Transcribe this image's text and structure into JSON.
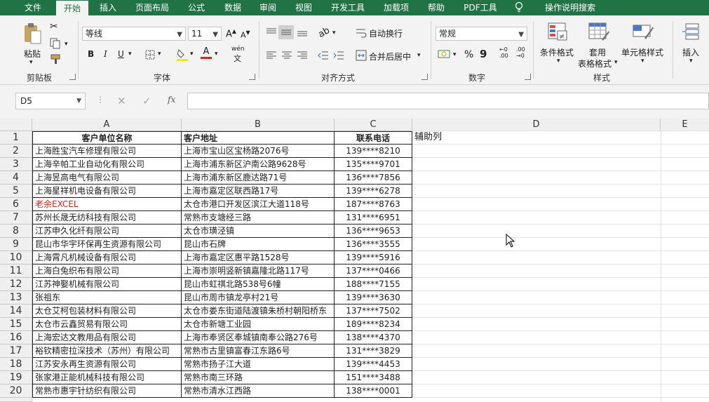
{
  "menu_tabs": [
    "文件",
    "开始",
    "插入",
    "页面布局",
    "公式",
    "数据",
    "审阅",
    "视图",
    "开发工具",
    "加载项",
    "帮助",
    "PDF工具",
    "操作说明搜索"
  ],
  "ribbon": {
    "clipboard": {
      "paste": "粘贴",
      "group": "剪贴板"
    },
    "font": {
      "name": "等线",
      "size": "11",
      "group": "字体",
      "bold": "B",
      "italic": "I",
      "underline": "U",
      "phonetic": "wén"
    },
    "alignment": {
      "wrap": "自动换行",
      "merge": "合并后居中",
      "group": "对齐方式"
    },
    "number": {
      "format": "常规",
      "percent": "%",
      "comma": "9",
      "group": "数字"
    },
    "styles": {
      "conditional": "条件格式",
      "table_format_1": "套用",
      "table_format_2": "表格格式",
      "cell_styles": "单元格样式",
      "group": "样式"
    },
    "cells": {
      "insert": "插入"
    }
  },
  "formula_bar": {
    "name_box": "D5",
    "fx": "fx",
    "value": ""
  },
  "columns": [
    "A",
    "B",
    "C",
    "D",
    "E"
  ],
  "rows": [
    [
      "客户单位名称",
      "客户地址",
      "联系电话",
      "辅助列"
    ],
    [
      "上海胜宝汽车修理有限公司",
      "上海市宝山区宝杨路2076号",
      "139****8210"
    ],
    [
      "上海辛帕工业自动化有限公司",
      "上海市浦东新区沪南公路9628号",
      "135****9701"
    ],
    [
      "上海昱高电气有限公司",
      "上海市浦东新区鹿达路71号",
      "136****7856"
    ],
    [
      "上海星祥机电设备有限公司",
      "上海市嘉定区联西路17号",
      "139****6278"
    ],
    [
      "老余EXCEL",
      "太仓市港口开发区滨江大道118号",
      "187****8763"
    ],
    [
      "苏州长晟无纺科技有限公司",
      "常熟市支塘经三路",
      "131****6951"
    ],
    [
      "江苏申久化纤有限公司",
      "太仓市璜泾镇",
      "136****9653"
    ],
    [
      "昆山市华宇环保再生资源有限公司",
      "昆山市石牌",
      "136****3555"
    ],
    [
      "上海霄凡机械设备有限公司",
      "上海市嘉定区惠平路1528号",
      "139****5916"
    ],
    [
      "上海白兔织布有限公司",
      "上海市崇明竖新镇嘉隆北路117号",
      "137****0466"
    ],
    [
      "江苏神娶机械有限公司",
      "昆山市虹祺北路538号6幢",
      "188****7155"
    ],
    [
      "张祖东",
      "昆山市周市镇龙亭村21号",
      "139****3630"
    ],
    [
      "太仓艾柯包装材料有限公司",
      "太仓市娄东街道陆渡镇朱桥村朝阳桥东",
      "137****7502"
    ],
    [
      "太仓市云鑫贸易有限公司",
      "太仓市新塘工业园",
      "189****8234"
    ],
    [
      "上海宏达文教用品有限公司",
      "上海市奉贤区奉城镇南奉公路276号",
      "138****4370"
    ],
    [
      "裕钦精密拉深技术（苏州）有限公司",
      "常熟市古里镇富春江东路6号",
      "131****3829"
    ],
    [
      "江苏安永再生资源有限公司",
      "常熟市扬子江大道",
      "139****4453"
    ],
    [
      "张家港正能机械科技有限公司",
      "常熟市南三环路",
      "151****3488"
    ],
    [
      "常熟市惠宇针纺织有限公司",
      "常熟市清水江西路",
      "138****0001"
    ]
  ],
  "colors": {
    "accent": "#217346",
    "red_text": "#d9241c"
  }
}
